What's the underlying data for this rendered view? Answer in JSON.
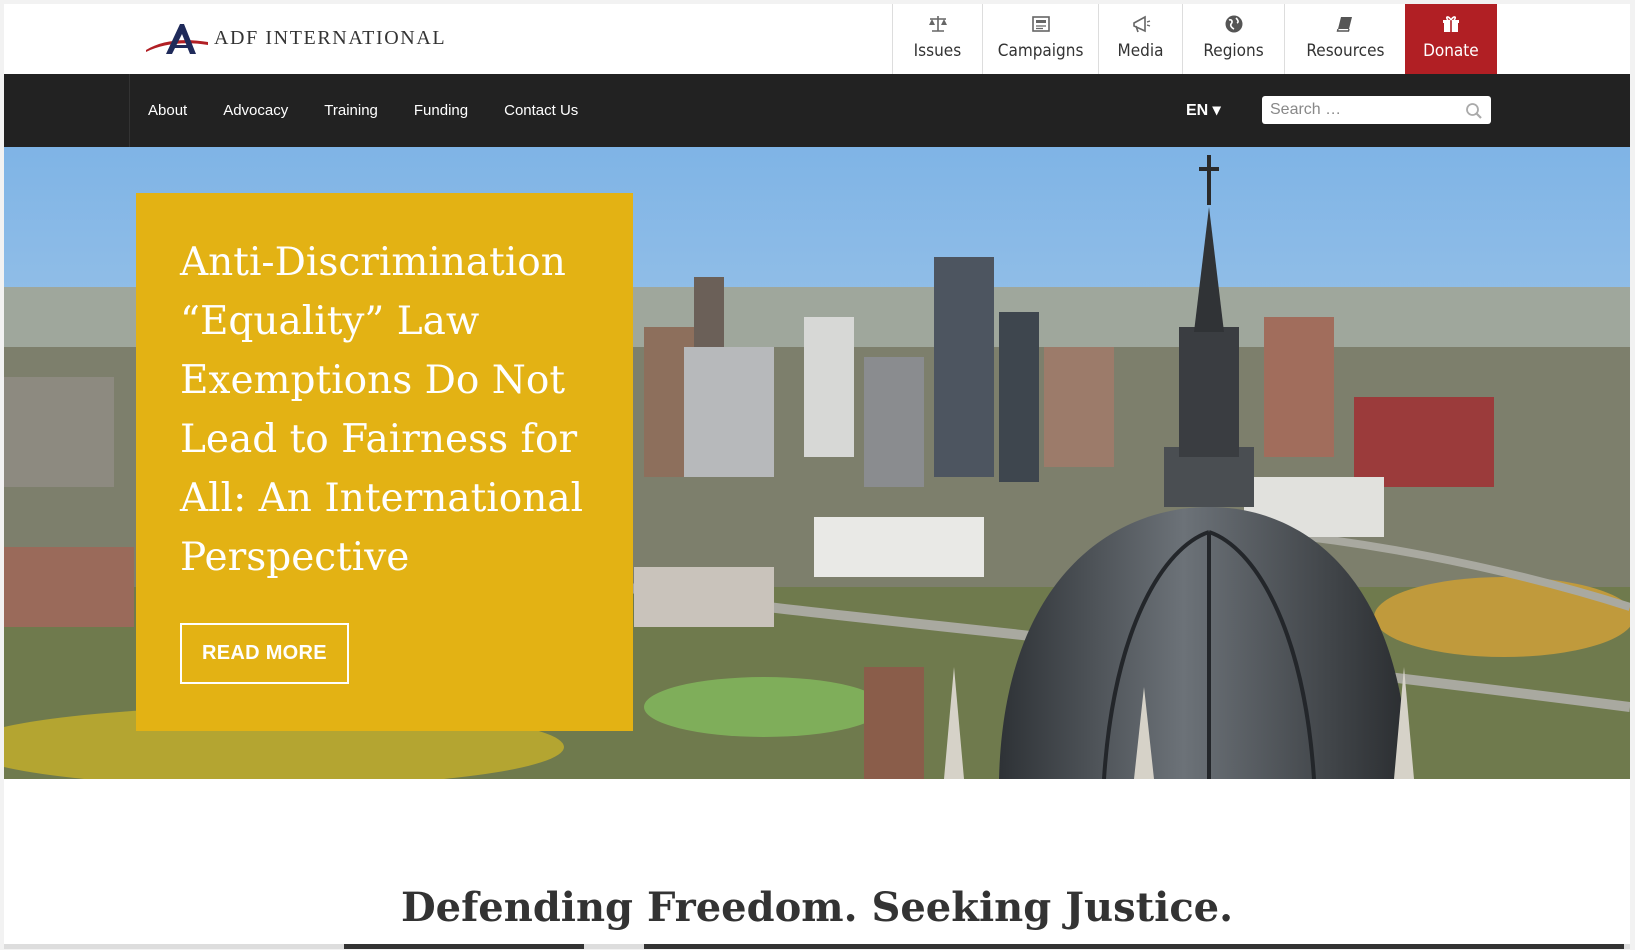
{
  "logo": {
    "text": "ADF INTERNATIONAL"
  },
  "topnav": [
    {
      "label": "Issues",
      "icon": "scales-icon"
    },
    {
      "label": "Campaigns",
      "icon": "newspaper-icon"
    },
    {
      "label": "Media",
      "icon": "megaphone-icon"
    },
    {
      "label": "Regions",
      "icon": "globe-icon"
    },
    {
      "label": "Resources",
      "icon": "book-icon"
    },
    {
      "label": "Donate",
      "icon": "gift-icon"
    }
  ],
  "secnav": {
    "links": [
      "About",
      "Advocacy",
      "Training",
      "Funding",
      "Contact Us"
    ],
    "language": "EN ▾",
    "search_placeholder": "Search …"
  },
  "hero": {
    "title": "Anti-Discrimination “Equality” Law Exemptions Do Not Lead to Fairness for All: An International Perspective",
    "button": "READ MORE"
  },
  "tagline": "Defending Freedom. Seeking Justice.",
  "colors": {
    "accent_gold": "#e3b214",
    "donate_red": "#b11f24",
    "nav_dark": "#222222"
  }
}
